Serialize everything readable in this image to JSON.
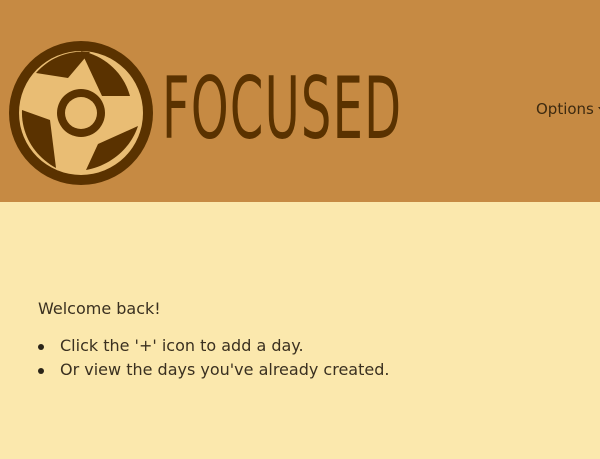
{
  "header": {
    "brand_text": "FOCUSED",
    "options_label": "Options"
  },
  "main": {
    "welcome": "Welcome back!",
    "tips": [
      "Click the '+' icon to add a day.",
      "Or view the days you've already created."
    ]
  },
  "colors": {
    "header_bg": "#c68a43",
    "page_bg": "#fbe8ad",
    "brand_dark": "#5a3200"
  },
  "icons": {
    "logo": "aperture-icon",
    "options": "caret-down-icon"
  }
}
